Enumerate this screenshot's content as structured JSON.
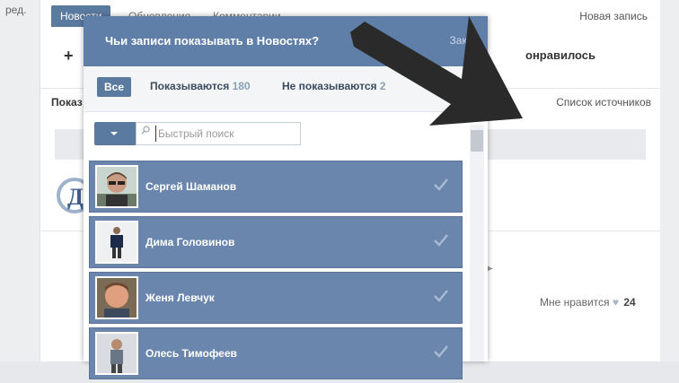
{
  "background": {
    "left_text": "ред.",
    "tabs": [
      {
        "label": "Новости"
      },
      {
        "label": "Обновления"
      },
      {
        "label": "Комментарии"
      }
    ],
    "new_post": "Новая запись",
    "plus_icon": "plus-icon",
    "liked_label": "онравилось",
    "show_label": "Показ",
    "sources_link": "Список источников",
    "likes": {
      "label": "Мне нравится",
      "count": "24"
    }
  },
  "dialog": {
    "title": "Чьи записи показывать в Новостях?",
    "close": "Закры",
    "filters": {
      "all": "Все",
      "shown_label": "Показываются",
      "shown_count": "180",
      "hidden_label": "Не показываются",
      "hidden_count": "2"
    },
    "search": {
      "placeholder": "Быстрый поиск",
      "value": ""
    },
    "items": [
      {
        "name": "Сергей Шаманов"
      },
      {
        "name": "Дима Головинов"
      },
      {
        "name": "Женя Левчук"
      },
      {
        "name": "Олесь Тимофеев"
      }
    ]
  },
  "colors": {
    "header": "#5f7ea8",
    "item_bg": "#6b86ad",
    "accent": "#5b7aa0",
    "arrow": "#2a2a2a"
  }
}
